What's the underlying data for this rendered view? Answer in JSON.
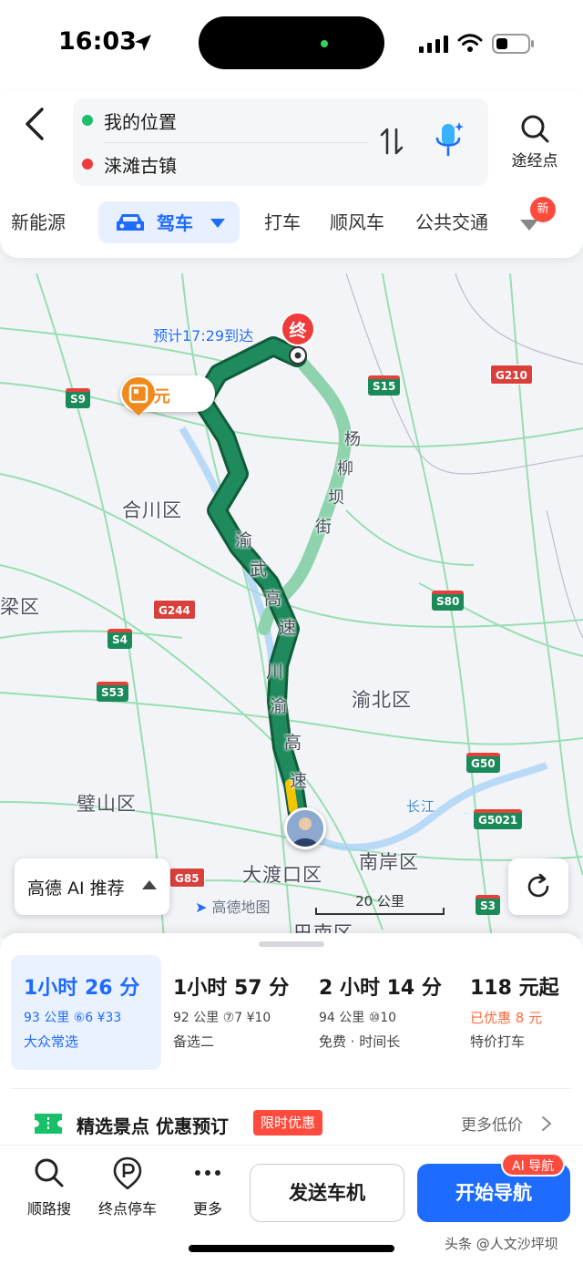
{
  "status_bar": {
    "time": "16:03"
  },
  "header": {
    "origin": "我的位置",
    "destination": "涞滩古镇",
    "waypoint_label": "途经点",
    "modes": [
      "新能源",
      "驾车",
      "打车",
      "顺风车",
      "公共交通"
    ],
    "active_mode": "驾车",
    "new_badge": "新"
  },
  "map": {
    "eta": "预计17:29到达",
    "toll": "33元",
    "end_marker": "终",
    "districts": [
      "合川区",
      "渝北区",
      "璧山区",
      "大渡口区",
      "南岸区",
      "梁区",
      "巴南区"
    ],
    "road_labels": [
      "杨",
      "柳",
      "坝",
      "街",
      "渝",
      "武",
      "高",
      "速",
      "川",
      "渝",
      "高",
      "速",
      "长江"
    ],
    "shields": [
      "S9",
      "S15",
      "G210",
      "S4",
      "G244",
      "S80",
      "S53",
      "G50",
      "G5021",
      "G85",
      "S3"
    ],
    "ai_recommend": "高德 AI 推荐",
    "brand": "高德地图",
    "scale": "20 公里",
    "colors": {
      "route_main": "#1f8a5c",
      "route_alt": "#8fd3ae",
      "road": "#7ad19a",
      "accent": "#1e6bff"
    }
  },
  "routes": [
    {
      "time": "1小时 26 分",
      "detail": "93 公里 ⑥6 ¥33",
      "tag": "大众常选"
    },
    {
      "time": "1小时 57 分",
      "detail": "92 公里 ⑦7 ¥10",
      "tag": "备选二"
    },
    {
      "time": "2 小时 14 分",
      "detail": "94 公里 ⑩10",
      "tag": "免费 · 时间长"
    },
    {
      "time": "118 元起",
      "detail": "已优惠 8 元",
      "tag": "特价打车"
    }
  ],
  "promo": {
    "title": "精选景点 优惠预订",
    "badge": "限时优惠",
    "more": "更多低价"
  },
  "bottom_bar": {
    "tools": [
      "顺路搜",
      "终点停车",
      "更多"
    ],
    "send_car": "发送车机",
    "start_nav": "开始导航",
    "ai_nav_badge": "AI 导航"
  },
  "watermark": "头条 @人文沙坪坝"
}
